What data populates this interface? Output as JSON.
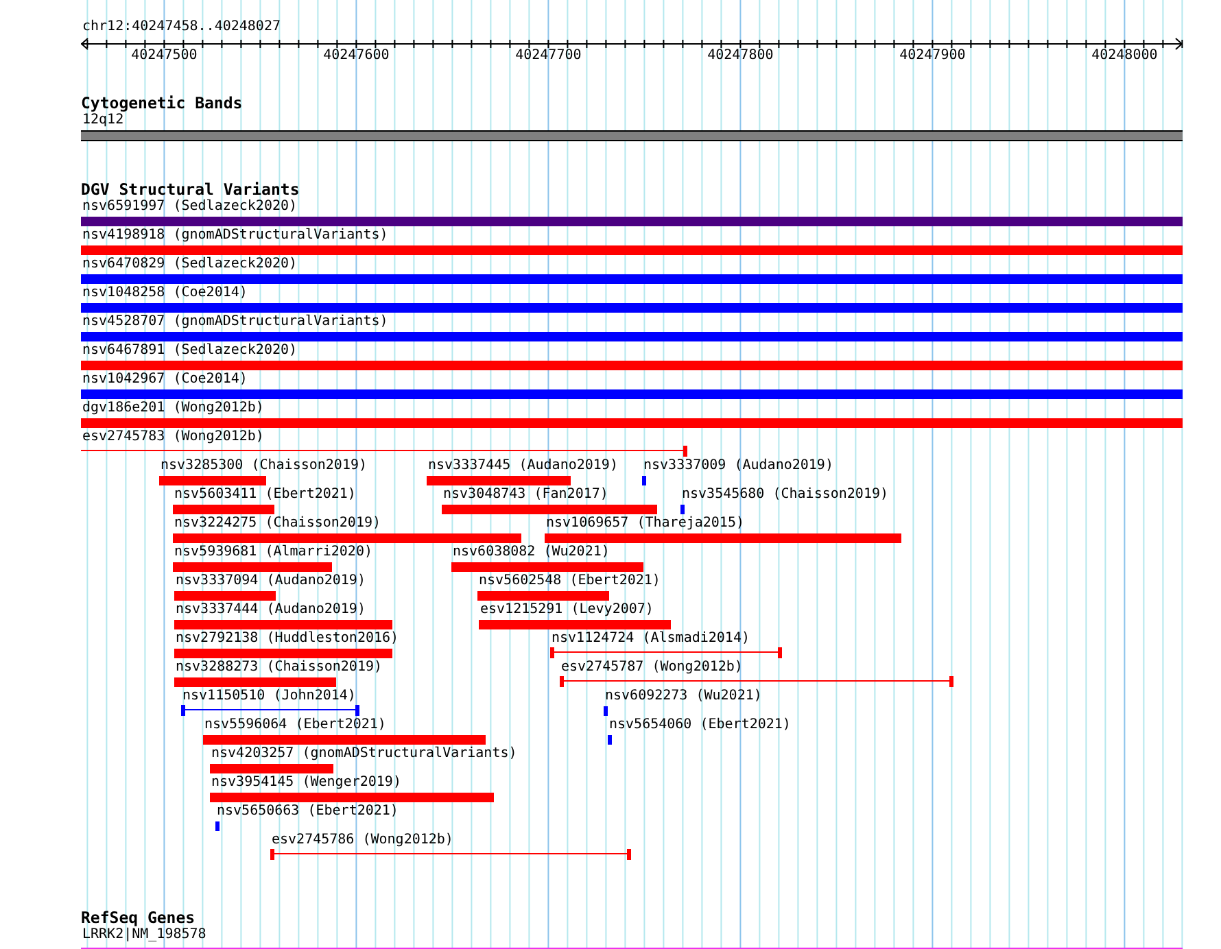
{
  "location": "chr12:40247458..40248027",
  "ruler": {
    "labels": [
      "40247500",
      "40247600",
      "40247700",
      "40247800",
      "40247900",
      "40248000"
    ]
  },
  "cytogenetic_bands": {
    "title": "Cytogenetic Bands",
    "features": [
      {
        "label": "12q12"
      }
    ]
  },
  "dgv_structural_variants": {
    "title": "DGV Structural Variants",
    "rows": [
      [
        {
          "label": "nsv6591997 (Sedlazeck2020)",
          "kind": "block",
          "color": "#4b0082"
        }
      ],
      [
        {
          "label": "nsv4198918 (gnomADStructuralVariants)",
          "kind": "block",
          "color": "#ff0000"
        }
      ],
      [
        {
          "label": "nsv6470829 (Sedlazeck2020)",
          "kind": "block",
          "color": "#0000ff"
        }
      ],
      [
        {
          "label": "nsv1048258 (Coe2014)",
          "kind": "block",
          "color": "#0000ff"
        }
      ],
      [
        {
          "label": "nsv4528707 (gnomADStructuralVariants)",
          "kind": "block",
          "color": "#0000ff"
        }
      ],
      [
        {
          "label": "nsv6467891 (Sedlazeck2020)",
          "kind": "block",
          "color": "#ff0000"
        }
      ],
      [
        {
          "label": "nsv1042967 (Coe2014)",
          "kind": "block",
          "color": "#0000ff"
        }
      ],
      [
        {
          "label": "dgv186e201 (Wong2012b)",
          "kind": "block",
          "color": "#ff0000"
        }
      ],
      [
        {
          "label": "esv2745783 (Wong2012b)",
          "kind": "line",
          "color": "#ff0000"
        }
      ],
      [
        {
          "label": "nsv3285300 (Chaisson2019)",
          "kind": "block",
          "color": "#ff0000"
        },
        {
          "label": "nsv3337445 (Audano2019)",
          "kind": "block",
          "color": "#ff0000"
        },
        {
          "label": "nsv3337009 (Audano2019)",
          "kind": "block",
          "color": "#0000ff"
        }
      ],
      [
        {
          "label": "nsv5603411 (Ebert2021)",
          "kind": "block",
          "color": "#ff0000"
        },
        {
          "label": "nsv3048743 (Fan2017)",
          "kind": "block",
          "color": "#ff0000"
        },
        {
          "label": "nsv3545680 (Chaisson2019)",
          "kind": "block",
          "color": "#0000ff"
        }
      ],
      [
        {
          "label": "nsv3224275 (Chaisson2019)",
          "kind": "block",
          "color": "#ff0000"
        },
        {
          "label": "nsv1069657 (Thareja2015)",
          "kind": "block",
          "color": "#ff0000"
        }
      ],
      [
        {
          "label": "nsv5939681 (Almarri2020)",
          "kind": "block",
          "color": "#ff0000"
        },
        {
          "label": "nsv6038082 (Wu2021)",
          "kind": "block",
          "color": "#ff0000"
        }
      ],
      [
        {
          "label": "nsv3337094 (Audano2019)",
          "kind": "block",
          "color": "#ff0000"
        },
        {
          "label": "nsv5602548 (Ebert2021)",
          "kind": "block",
          "color": "#ff0000"
        }
      ],
      [
        {
          "label": "nsv3337444 (Audano2019)",
          "kind": "block",
          "color": "#ff0000"
        },
        {
          "label": "esv1215291 (Levy2007)",
          "kind": "block",
          "color": "#ff0000"
        }
      ],
      [
        {
          "label": "nsv2792138 (Huddleston2016)",
          "kind": "block",
          "color": "#ff0000"
        },
        {
          "label": "nsv1124724 (Alsmadi2014)",
          "kind": "line",
          "color": "#ff0000"
        }
      ],
      [
        {
          "label": "nsv3288273 (Chaisson2019)",
          "kind": "block",
          "color": "#ff0000"
        },
        {
          "label": "esv2745787 (Wong2012b)",
          "kind": "line",
          "color": "#ff0000"
        }
      ],
      [
        {
          "label": "nsv1150510 (John2014)",
          "kind": "line",
          "color": "#0000ff"
        },
        {
          "label": "nsv6092273 (Wu2021)",
          "kind": "block",
          "color": "#0000ff"
        }
      ],
      [
        {
          "label": "nsv5596064 (Ebert2021)",
          "kind": "block",
          "color": "#ff0000"
        },
        {
          "label": "nsv5654060 (Ebert2021)",
          "kind": "block",
          "color": "#0000ff"
        }
      ],
      [
        {
          "label": "nsv4203257 (gnomADStructuralVariants)",
          "kind": "block",
          "color": "#ff0000"
        }
      ],
      [
        {
          "label": "nsv3954145 (Wenger2019)",
          "kind": "block",
          "color": "#ff0000"
        }
      ],
      [
        {
          "label": "nsv5650663 (Ebert2021)",
          "kind": "block",
          "color": "#0000ff"
        }
      ],
      [
        {
          "label": "esv2745786 (Wong2012b)",
          "kind": "line",
          "color": "#ff0000"
        }
      ]
    ]
  },
  "refseq_genes": {
    "title": "RefSeq Genes",
    "features": [
      {
        "label": "LRRK2|NM_198578"
      }
    ]
  }
}
